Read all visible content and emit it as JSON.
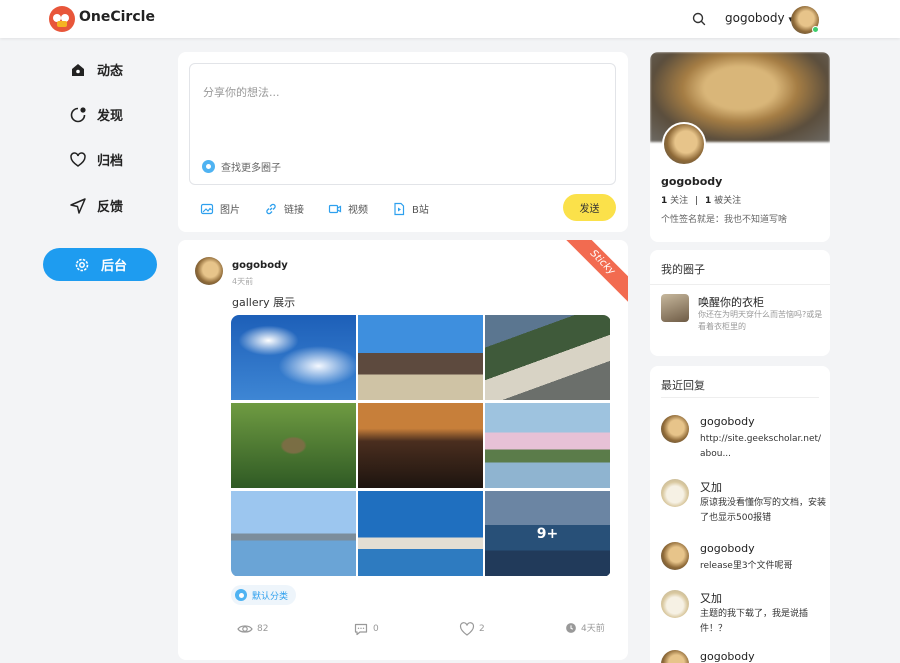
{
  "header": {
    "brand": "OneCircle",
    "username": "gogobody",
    "dropdown_caret": "▾"
  },
  "nav": {
    "items": [
      {
        "label": "动态",
        "icon": "home-icon"
      },
      {
        "label": "发现",
        "icon": "discover-icon"
      },
      {
        "label": "归档",
        "icon": "heart-icon"
      },
      {
        "label": "反馈",
        "icon": "send-icon"
      }
    ],
    "admin_label": "后台",
    "admin_icon": "gear-icon"
  },
  "composer": {
    "placeholder": "分享你的想法...",
    "circle_finder": "查找更多圈子",
    "tools": [
      {
        "label": "图片",
        "icon": "image-icon"
      },
      {
        "label": "链接",
        "icon": "link-icon"
      },
      {
        "label": "视频",
        "icon": "video-icon"
      },
      {
        "label": "B站",
        "icon": "bilibili-icon"
      }
    ],
    "send_label": "发送"
  },
  "post": {
    "ribbon": "Sticky",
    "author": "gogobody",
    "time": "4天前",
    "text": "gallery 展示",
    "more_count": "9+",
    "tag": "默认分类",
    "views": "82",
    "comments": "0",
    "likes": "2",
    "posted": "4天前"
  },
  "profile": {
    "name": "gogobody",
    "following_count": "1",
    "following_label": "关注",
    "followers_count": "1",
    "followers_label": "被关注",
    "signature": "个性签名就是：我也不知道写啥"
  },
  "circles": {
    "title": "我的圈子",
    "items": [
      {
        "name": "唤醒你的衣柜",
        "desc": "你还在为明天穿什么而苦恼吗?或是看着衣柜里的"
      }
    ]
  },
  "replies": {
    "title": "最近回复",
    "items": [
      {
        "name": "gogobody",
        "text": "http://site.geekscholar.net/abou...",
        "avatar": "wood"
      },
      {
        "name": "又加",
        "text": "原谅我没看懂你写的文档，安装了也显示500报错",
        "avatar": "cat"
      },
      {
        "name": "gogobody",
        "text": "release里3个文件呢哥",
        "avatar": "wood"
      },
      {
        "name": "又加",
        "text": "主题的我下载了，我是说插件！？",
        "avatar": "cat"
      },
      {
        "name": "gogobody",
        "text": "",
        "avatar": "wood"
      }
    ]
  },
  "colors": {
    "accent": "#1e9cf0",
    "send": "#fbe14a",
    "ribbon": "#f26b50",
    "background": "#f3f4f6"
  }
}
